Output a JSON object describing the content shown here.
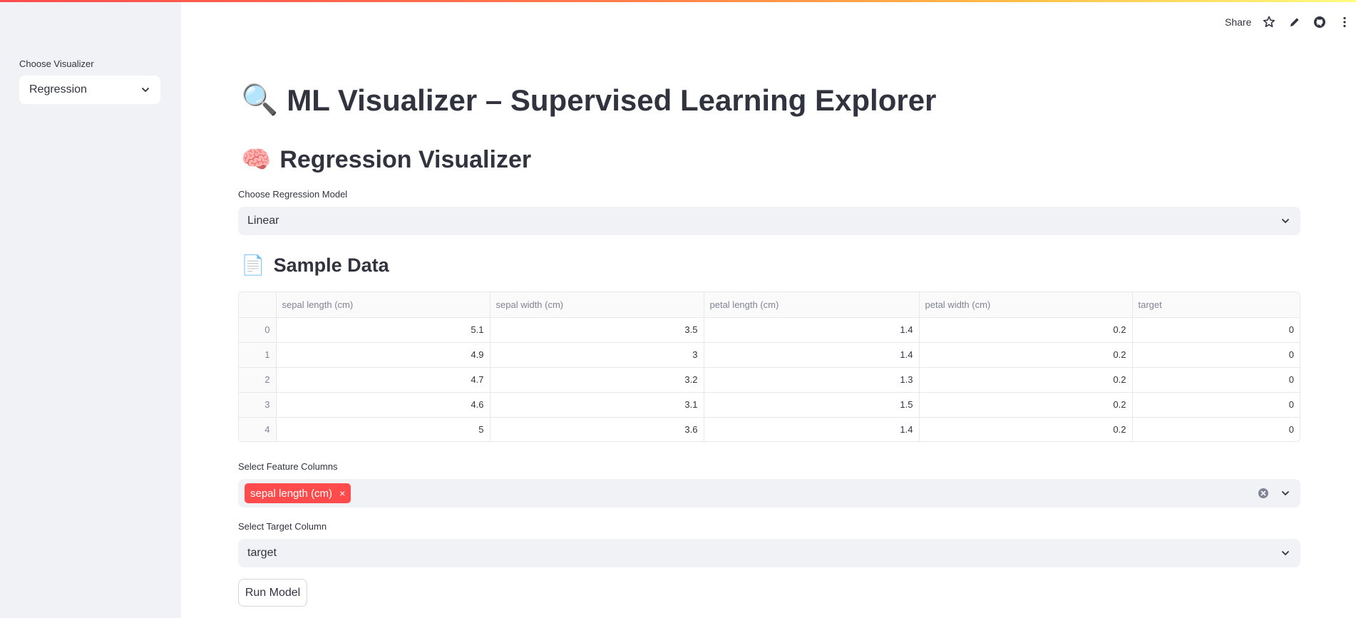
{
  "toolbar": {
    "share_label": "Share",
    "icons": [
      "star-icon",
      "pencil-icon",
      "github-icon",
      "more-icon"
    ]
  },
  "sidebar": {
    "visualizer_label": "Choose Visualizer",
    "visualizer_value": "Regression"
  },
  "main": {
    "title": "ML Visualizer – Supervised Learning Explorer",
    "title_emoji": "🔍",
    "section_title": "Regression Visualizer",
    "section_emoji": "🧠",
    "model_label": "Choose Regression Model",
    "model_value": "Linear",
    "sample_title": "Sample Data",
    "sample_emoji": "📄",
    "table": {
      "columns": [
        "",
        "sepal length (cm)",
        "sepal width (cm)",
        "petal length (cm)",
        "petal width (cm)",
        "target"
      ],
      "rows": [
        [
          "0",
          "5.1",
          "3.5",
          "1.4",
          "0.2",
          "0"
        ],
        [
          "1",
          "4.9",
          "3",
          "1.4",
          "0.2",
          "0"
        ],
        [
          "2",
          "4.7",
          "3.2",
          "1.3",
          "0.2",
          "0"
        ],
        [
          "3",
          "4.6",
          "3.1",
          "1.5",
          "0.2",
          "0"
        ],
        [
          "4",
          "5",
          "3.6",
          "1.4",
          "0.2",
          "0"
        ]
      ]
    },
    "feature_label": "Select Feature Columns",
    "feature_chips": [
      "sepal length (cm)"
    ],
    "chip_remove": "×",
    "target_label": "Select Target Column",
    "target_value": "target",
    "run_button": "Run Model"
  },
  "colors": {
    "accent": "#ff4b4b",
    "sidebar_bg": "#f0f2f6",
    "text": "#31333f",
    "muted": "#808495"
  }
}
